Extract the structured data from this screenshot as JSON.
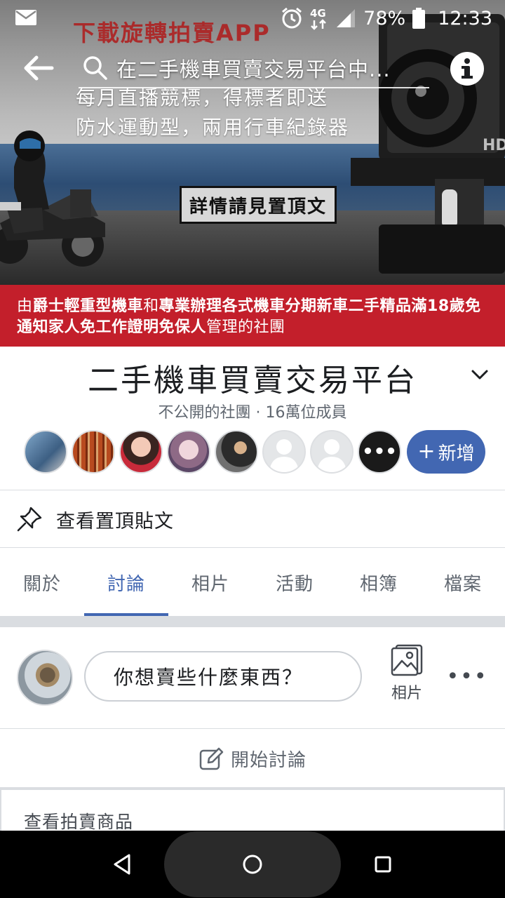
{
  "status_bar": {
    "battery": "78%",
    "time": "12:33",
    "network": "4G",
    "icons": [
      "mail-icon",
      "alarm-icon",
      "4g-icon",
      "signal-icon",
      "battery-icon"
    ]
  },
  "cover": {
    "ad_title": "下載旋轉拍賣APP",
    "line1": "每月直播競標，得標者即送",
    "line2": "防水運動型，兩用行車紀錄器",
    "notice": "詳情請見置頂文"
  },
  "search": {
    "text": "在二手機車買賣交易平台中..."
  },
  "banner": {
    "p1": "由",
    "b1": "爵士輕重型機車",
    "p2": "和",
    "b2": "專業辦理各式機車分期新車二手精品滿18歲免通知家人免工作證明免保人",
    "p3": "管理的社團"
  },
  "group": {
    "title": "二手機車買賣交易平台",
    "meta": "不公開的社團 · 16萬位成員",
    "add_label": "新增",
    "more_members": "•••"
  },
  "pinned": {
    "label": "查看置頂貼文"
  },
  "tabs": [
    {
      "label": "關於"
    },
    {
      "label": "討論"
    },
    {
      "label": "相片"
    },
    {
      "label": "活動"
    },
    {
      "label": "相簿"
    },
    {
      "label": "檔案"
    }
  ],
  "active_tab": "討論",
  "composer": {
    "placeholder": "你想賣些什麼東西？",
    "photo_label": "相片",
    "more": "•••"
  },
  "start_discussion": {
    "label": "開始討論"
  },
  "auction": {
    "label": "查看拍賣商品"
  },
  "colors": {
    "brand": "#4267b2",
    "banner_red": "#c31f2b"
  }
}
